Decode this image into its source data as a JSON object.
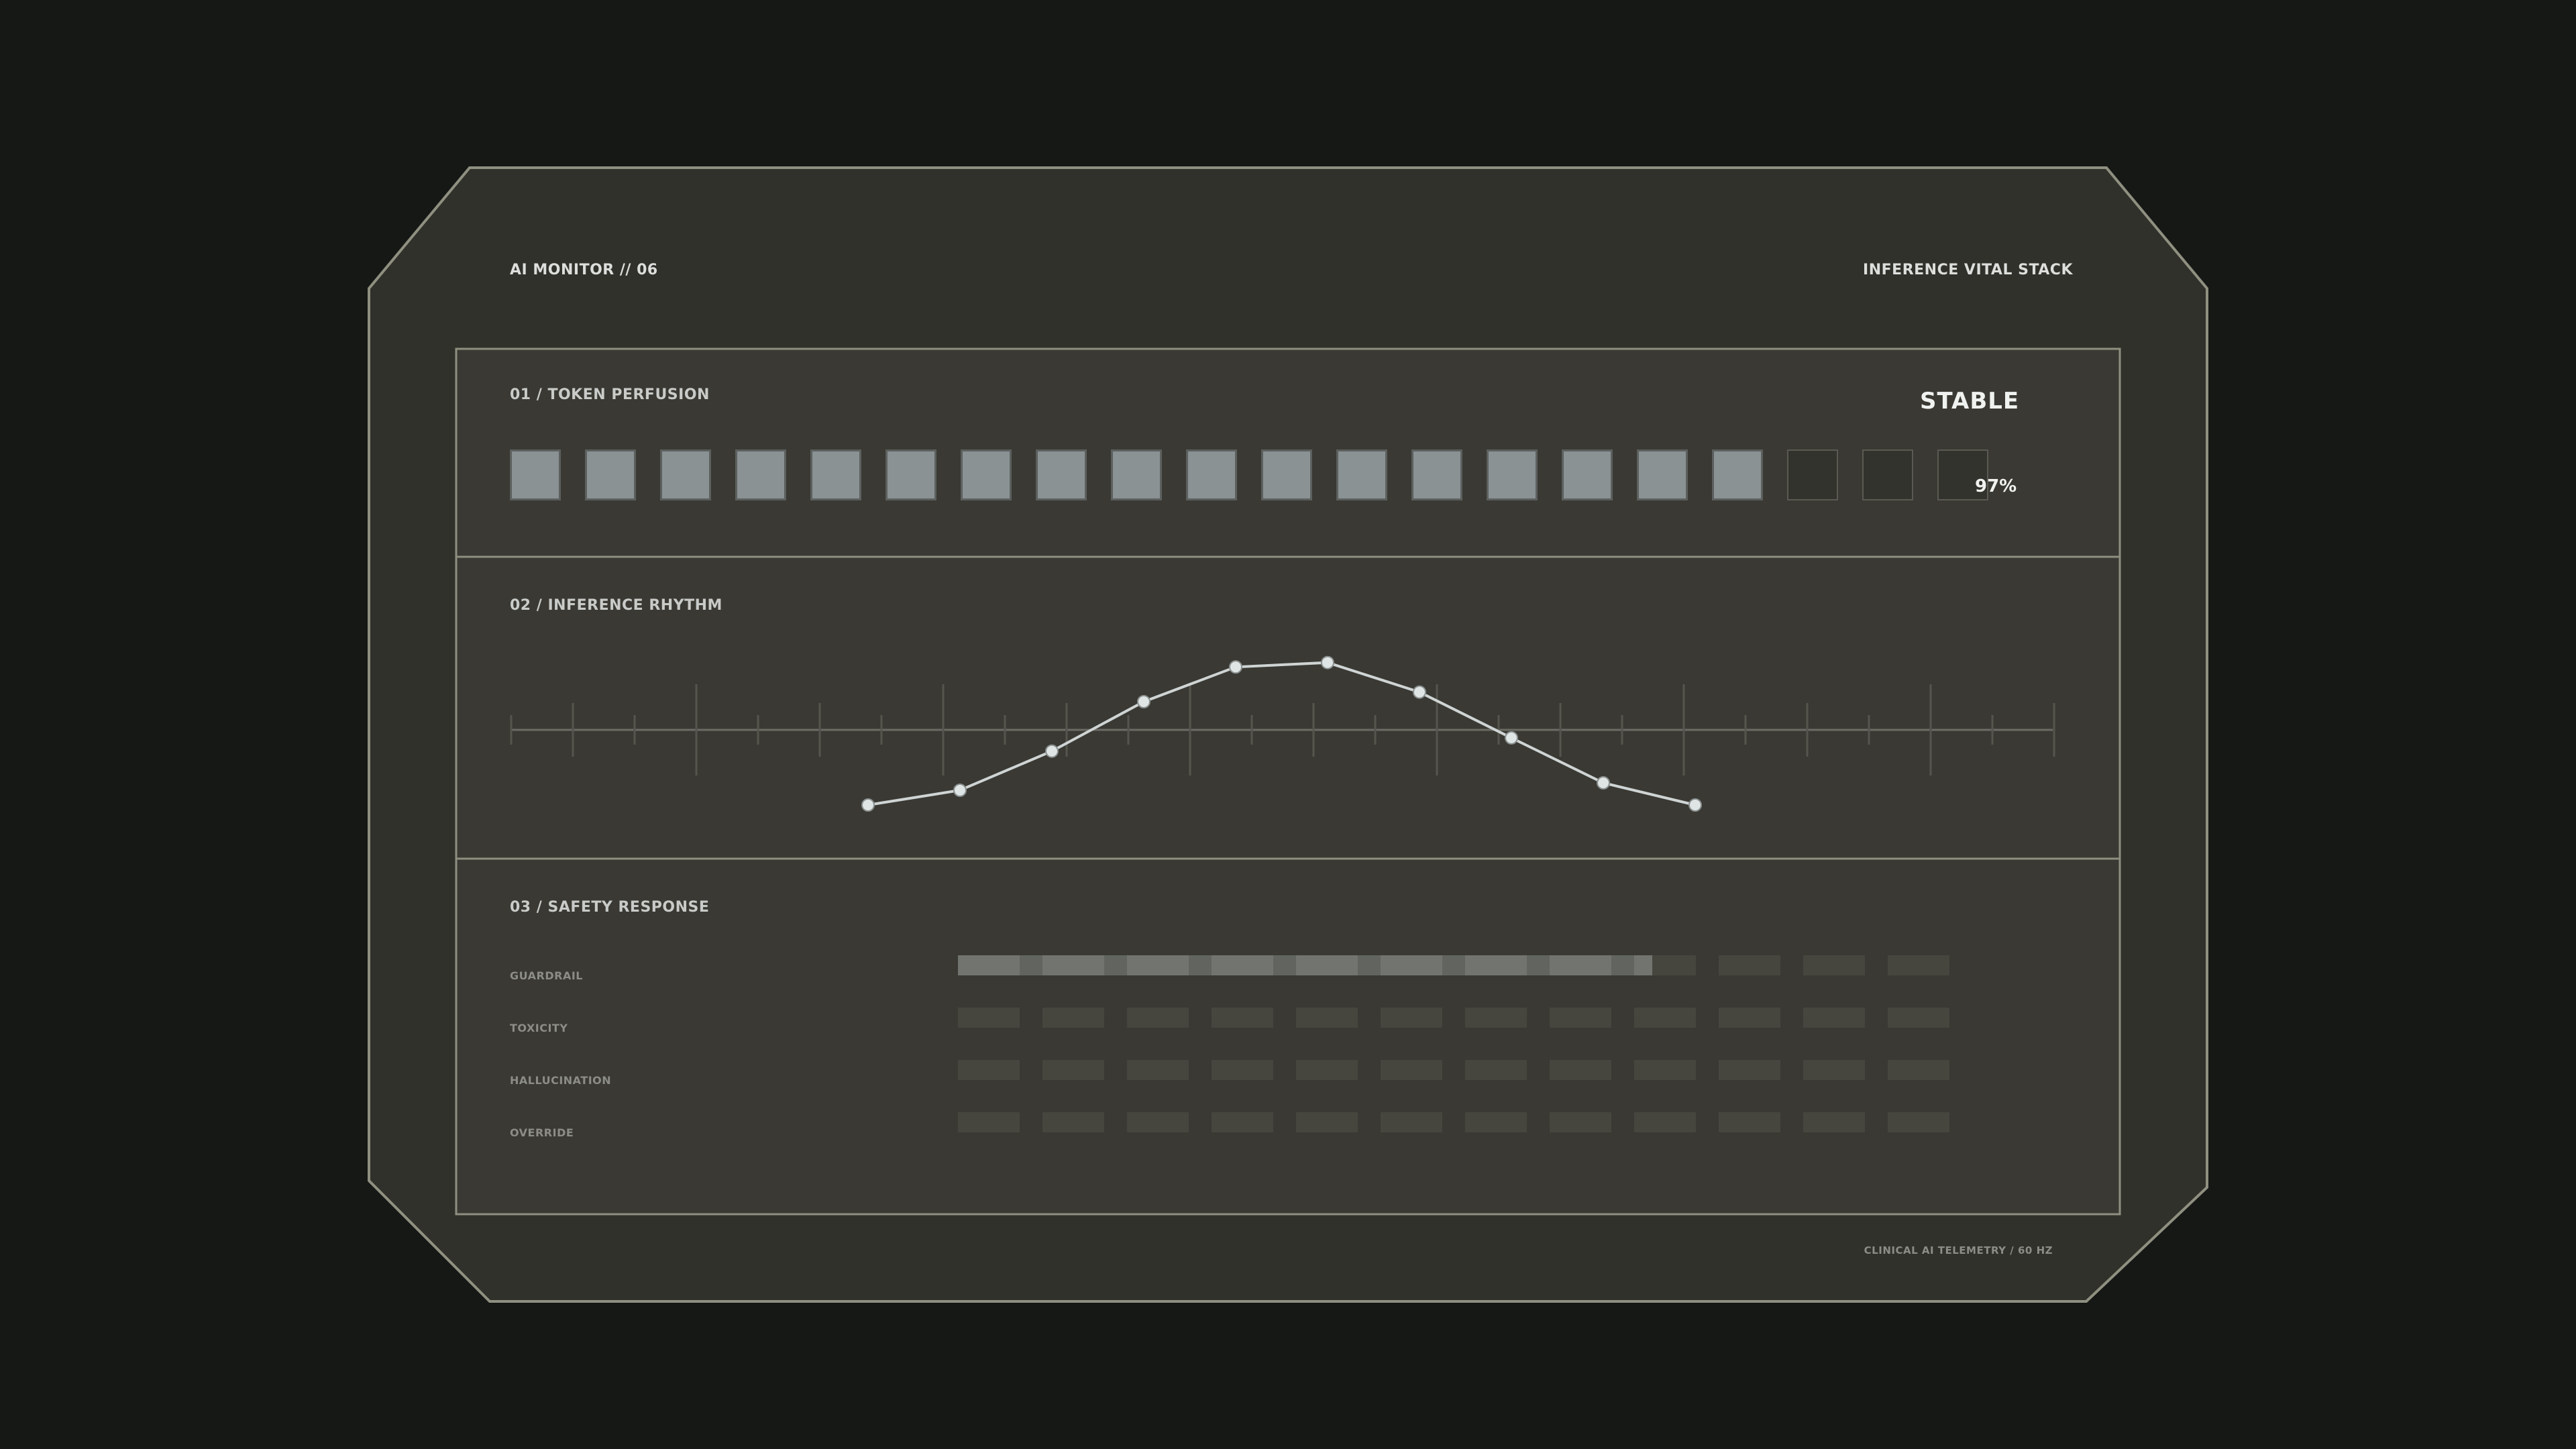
{
  "header": {
    "left_title": "AI MONITOR // 06",
    "right_title": "INFERENCE VITAL STACK"
  },
  "token_perfusion": {
    "title": "01 / TOKEN PERFUSION",
    "status": "STABLE",
    "percent_label": "97%",
    "cells_total": 20,
    "cells_filled": 17
  },
  "inference_rhythm": {
    "title": "02 / INFERENCE RHYTHM"
  },
  "safety_response": {
    "title": "03 / SAFETY RESPONSE",
    "segments_per_row": 12,
    "rows": [
      {
        "label": "GUARDRAIL",
        "level": 0.7
      },
      {
        "label": "TOXICITY",
        "level": 0
      },
      {
        "label": "HALLUCINATION",
        "level": 0
      },
      {
        "label": "OVERRIDE",
        "level": 0
      }
    ]
  },
  "footer": {
    "text": "CLINICAL AI TELEMETRY / 60 HZ"
  },
  "chart_data": {
    "type": "line",
    "title": "",
    "xlabel": "",
    "ylabel": "",
    "x": [
      1,
      2,
      3,
      4,
      5,
      6,
      7,
      8,
      9,
      10
    ],
    "series": [
      {
        "values": [
          -1.0,
          -0.8,
          -0.27,
          0.4,
          0.87,
          0.93,
          0.53,
          -0.09,
          -0.7,
          -1.0
        ]
      }
    ],
    "ylim": [
      -1.1,
      1.1
    ],
    "grid": false
  },
  "colors": {
    "background": "#161816",
    "panel": "#31312b",
    "inner_panel": "#3a3933",
    "frame_stroke": "#8f9080",
    "cell_on": "#8b9294",
    "trace": "#cfd4d4",
    "segment_active": "#6f716d",
    "segment_idle": "#46463f"
  }
}
